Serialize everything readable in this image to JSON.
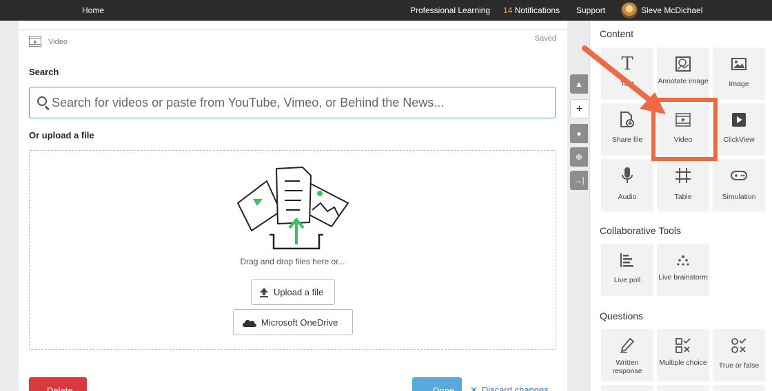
{
  "topbar": {
    "home": "Home",
    "professional_learning": "Professional Learning",
    "notif_count": "14",
    "notifications": "Notifications",
    "support": "Support",
    "user_name": "Sleve McDichael"
  },
  "editor": {
    "block_type": "Video",
    "status": "Saved",
    "search_label": "Search",
    "search_placeholder": "Search for videos or paste from YouTube, Vimeo, or Behind the News...",
    "upload_label": "Or upload a file",
    "drop_text": "Drag and drop files here or...",
    "upload_button": "Upload a file",
    "onedrive_button": "Microsoft OneDrive",
    "delete_button": "Delete",
    "done_button": "Done",
    "discard_link": "Discard changes"
  },
  "panel": {
    "content_title": "Content",
    "content_items": [
      {
        "label": "Text",
        "icon": "text-icon"
      },
      {
        "label": "Annotate image",
        "icon": "annotate-image-icon"
      },
      {
        "label": "Image",
        "icon": "image-icon"
      },
      {
        "label": "Share file",
        "icon": "share-file-icon"
      },
      {
        "label": "Video",
        "icon": "video-icon"
      },
      {
        "label": "ClickView",
        "icon": "clickview-icon"
      },
      {
        "label": "Audio",
        "icon": "microphone-icon"
      },
      {
        "label": "Table",
        "icon": "table-icon"
      },
      {
        "label": "Simulation",
        "icon": "gamepad-icon"
      }
    ],
    "collab_title": "Collaborative Tools",
    "collab_items": [
      {
        "label": "Live poll",
        "icon": "bar-chart-icon"
      },
      {
        "label": "Live brainstorm",
        "icon": "brainstorm-icon"
      }
    ],
    "questions_title": "Questions",
    "question_items": [
      {
        "label": "Written response",
        "icon": "pen-icon"
      },
      {
        "label": "Multiple choice",
        "icon": "multiple-choice-icon"
      },
      {
        "label": "True or false",
        "icon": "true-false-icon"
      }
    ]
  },
  "colors": {
    "accent": "#4aa3df",
    "delete": "#d9383e",
    "done": "#5aa9dc",
    "annotation": "#ee6a45",
    "notif": "#f0a23c"
  }
}
